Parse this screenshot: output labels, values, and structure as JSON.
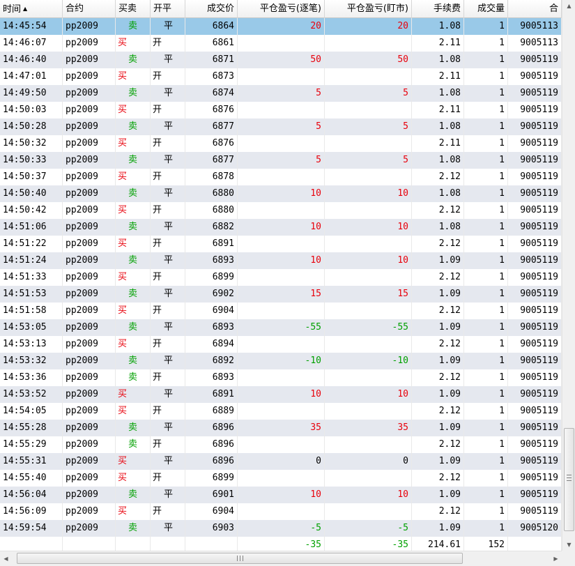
{
  "columns": [
    {
      "label": "时间"
    },
    {
      "label": "合约"
    },
    {
      "label": "买卖"
    },
    {
      "label": "开平"
    },
    {
      "label": "成交价"
    },
    {
      "label": "平仓盈亏(逐笔)"
    },
    {
      "label": "平仓盈亏(盯市)"
    },
    {
      "label": "手续费"
    },
    {
      "label": "成交量"
    },
    {
      "label": "合"
    }
  ],
  "sort_icon": "sort-ascending-icon",
  "sort_glyph": "▲",
  "colors": {
    "profit": "#e8000b",
    "loss": "#00a000",
    "selected": "#99c9e8",
    "stripe": "#e5e8ef"
  },
  "rows": [
    {
      "time": "14:45:54",
      "contract": "pp2009",
      "side": "卖",
      "oc": "平",
      "price": "6864",
      "pnl_trade": "20",
      "pnl_mtm": "20",
      "fee": "1.08",
      "qty": "1",
      "id": "9005113"
    },
    {
      "time": "14:46:07",
      "contract": "pp2009",
      "side": "买",
      "oc": "开",
      "price": "6861",
      "pnl_trade": "",
      "pnl_mtm": "",
      "fee": "2.11",
      "qty": "1",
      "id": "9005113"
    },
    {
      "time": "14:46:40",
      "contract": "pp2009",
      "side": "卖",
      "oc": "平",
      "price": "6871",
      "pnl_trade": "50",
      "pnl_mtm": "50",
      "fee": "1.08",
      "qty": "1",
      "id": "9005119"
    },
    {
      "time": "14:47:01",
      "contract": "pp2009",
      "side": "买",
      "oc": "开",
      "price": "6873",
      "pnl_trade": "",
      "pnl_mtm": "",
      "fee": "2.11",
      "qty": "1",
      "id": "9005119"
    },
    {
      "time": "14:49:50",
      "contract": "pp2009",
      "side": "卖",
      "oc": "平",
      "price": "6874",
      "pnl_trade": "5",
      "pnl_mtm": "5",
      "fee": "1.08",
      "qty": "1",
      "id": "9005119"
    },
    {
      "time": "14:50:03",
      "contract": "pp2009",
      "side": "买",
      "oc": "开",
      "price": "6876",
      "pnl_trade": "",
      "pnl_mtm": "",
      "fee": "2.11",
      "qty": "1",
      "id": "9005119"
    },
    {
      "time": "14:50:28",
      "contract": "pp2009",
      "side": "卖",
      "oc": "平",
      "price": "6877",
      "pnl_trade": "5",
      "pnl_mtm": "5",
      "fee": "1.08",
      "qty": "1",
      "id": "9005119"
    },
    {
      "time": "14:50:32",
      "contract": "pp2009",
      "side": "买",
      "oc": "开",
      "price": "6876",
      "pnl_trade": "",
      "pnl_mtm": "",
      "fee": "2.11",
      "qty": "1",
      "id": "9005119"
    },
    {
      "time": "14:50:33",
      "contract": "pp2009",
      "side": "卖",
      "oc": "平",
      "price": "6877",
      "pnl_trade": "5",
      "pnl_mtm": "5",
      "fee": "1.08",
      "qty": "1",
      "id": "9005119"
    },
    {
      "time": "14:50:37",
      "contract": "pp2009",
      "side": "买",
      "oc": "开",
      "price": "6878",
      "pnl_trade": "",
      "pnl_mtm": "",
      "fee": "2.12",
      "qty": "1",
      "id": "9005119"
    },
    {
      "time": "14:50:40",
      "contract": "pp2009",
      "side": "卖",
      "oc": "平",
      "price": "6880",
      "pnl_trade": "10",
      "pnl_mtm": "10",
      "fee": "1.08",
      "qty": "1",
      "id": "9005119"
    },
    {
      "time": "14:50:42",
      "contract": "pp2009",
      "side": "买",
      "oc": "开",
      "price": "6880",
      "pnl_trade": "",
      "pnl_mtm": "",
      "fee": "2.12",
      "qty": "1",
      "id": "9005119"
    },
    {
      "time": "14:51:06",
      "contract": "pp2009",
      "side": "卖",
      "oc": "平",
      "price": "6882",
      "pnl_trade": "10",
      "pnl_mtm": "10",
      "fee": "1.08",
      "qty": "1",
      "id": "9005119"
    },
    {
      "time": "14:51:22",
      "contract": "pp2009",
      "side": "买",
      "oc": "开",
      "price": "6891",
      "pnl_trade": "",
      "pnl_mtm": "",
      "fee": "2.12",
      "qty": "1",
      "id": "9005119"
    },
    {
      "time": "14:51:24",
      "contract": "pp2009",
      "side": "卖",
      "oc": "平",
      "price": "6893",
      "pnl_trade": "10",
      "pnl_mtm": "10",
      "fee": "1.09",
      "qty": "1",
      "id": "9005119"
    },
    {
      "time": "14:51:33",
      "contract": "pp2009",
      "side": "买",
      "oc": "开",
      "price": "6899",
      "pnl_trade": "",
      "pnl_mtm": "",
      "fee": "2.12",
      "qty": "1",
      "id": "9005119"
    },
    {
      "time": "14:51:53",
      "contract": "pp2009",
      "side": "卖",
      "oc": "平",
      "price": "6902",
      "pnl_trade": "15",
      "pnl_mtm": "15",
      "fee": "1.09",
      "qty": "1",
      "id": "9005119"
    },
    {
      "time": "14:51:58",
      "contract": "pp2009",
      "side": "买",
      "oc": "开",
      "price": "6904",
      "pnl_trade": "",
      "pnl_mtm": "",
      "fee": "2.12",
      "qty": "1",
      "id": "9005119"
    },
    {
      "time": "14:53:05",
      "contract": "pp2009",
      "side": "卖",
      "oc": "平",
      "price": "6893",
      "pnl_trade": "-55",
      "pnl_mtm": "-55",
      "fee": "1.09",
      "qty": "1",
      "id": "9005119"
    },
    {
      "time": "14:53:13",
      "contract": "pp2009",
      "side": "买",
      "oc": "开",
      "price": "6894",
      "pnl_trade": "",
      "pnl_mtm": "",
      "fee": "2.12",
      "qty": "1",
      "id": "9005119"
    },
    {
      "time": "14:53:32",
      "contract": "pp2009",
      "side": "卖",
      "oc": "平",
      "price": "6892",
      "pnl_trade": "-10",
      "pnl_mtm": "-10",
      "fee": "1.09",
      "qty": "1",
      "id": "9005119"
    },
    {
      "time": "14:53:36",
      "contract": "pp2009",
      "side": "卖",
      "oc": "开",
      "price": "6893",
      "pnl_trade": "",
      "pnl_mtm": "",
      "fee": "2.12",
      "qty": "1",
      "id": "9005119"
    },
    {
      "time": "14:53:52",
      "contract": "pp2009",
      "side": "买",
      "oc": "平",
      "price": "6891",
      "pnl_trade": "10",
      "pnl_mtm": "10",
      "fee": "1.09",
      "qty": "1",
      "id": "9005119"
    },
    {
      "time": "14:54:05",
      "contract": "pp2009",
      "side": "买",
      "oc": "开",
      "price": "6889",
      "pnl_trade": "",
      "pnl_mtm": "",
      "fee": "2.12",
      "qty": "1",
      "id": "9005119"
    },
    {
      "time": "14:55:28",
      "contract": "pp2009",
      "side": "卖",
      "oc": "平",
      "price": "6896",
      "pnl_trade": "35",
      "pnl_mtm": "35",
      "fee": "1.09",
      "qty": "1",
      "id": "9005119"
    },
    {
      "time": "14:55:29",
      "contract": "pp2009",
      "side": "卖",
      "oc": "开",
      "price": "6896",
      "pnl_trade": "",
      "pnl_mtm": "",
      "fee": "2.12",
      "qty": "1",
      "id": "9005119"
    },
    {
      "time": "14:55:31",
      "contract": "pp2009",
      "side": "买",
      "oc": "平",
      "price": "6896",
      "pnl_trade": "0",
      "pnl_mtm": "0",
      "fee": "1.09",
      "qty": "1",
      "id": "9005119"
    },
    {
      "time": "14:55:40",
      "contract": "pp2009",
      "side": "买",
      "oc": "开",
      "price": "6899",
      "pnl_trade": "",
      "pnl_mtm": "",
      "fee": "2.12",
      "qty": "1",
      "id": "9005119"
    },
    {
      "time": "14:56:04",
      "contract": "pp2009",
      "side": "卖",
      "oc": "平",
      "price": "6901",
      "pnl_trade": "10",
      "pnl_mtm": "10",
      "fee": "1.09",
      "qty": "1",
      "id": "9005119"
    },
    {
      "time": "14:56:09",
      "contract": "pp2009",
      "side": "买",
      "oc": "开",
      "price": "6904",
      "pnl_trade": "",
      "pnl_mtm": "",
      "fee": "2.12",
      "qty": "1",
      "id": "9005119"
    },
    {
      "time": "14:59:54",
      "contract": "pp2009",
      "side": "卖",
      "oc": "平",
      "price": "6903",
      "pnl_trade": "-5",
      "pnl_mtm": "-5",
      "fee": "1.09",
      "qty": "1",
      "id": "9005120"
    }
  ],
  "totals": {
    "pnl_trade": "-35",
    "pnl_mtm": "-35",
    "fee": "214.61",
    "qty": "152"
  },
  "scrollbar": {
    "vertical_position": 0.98,
    "horizontal_position": 0.0,
    "up_icon": "arrow-up-icon",
    "down_icon": "arrow-down-icon",
    "left_icon": "arrow-left-icon",
    "right_icon": "arrow-right-icon",
    "grip_icon": "grip-icon",
    "up_glyph": "▲",
    "down_glyph": "▼",
    "left_glyph": "◀",
    "right_glyph": "▶"
  }
}
